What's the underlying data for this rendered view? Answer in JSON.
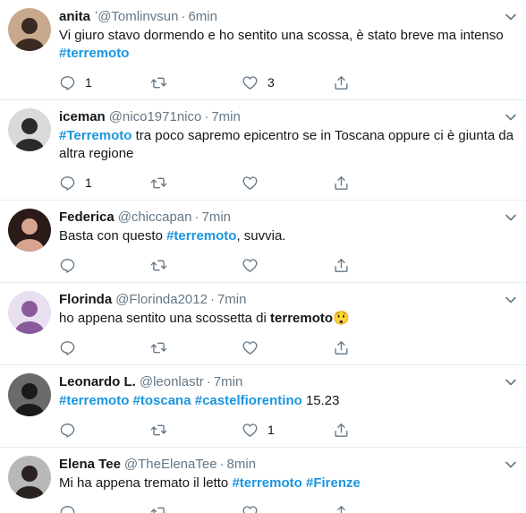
{
  "tweets": [
    {
      "name": "anita ͘͘",
      "handle": "@Tomlinvsun",
      "time": "6min",
      "text_parts": [
        {
          "t": "Vi giuro stavo dormendo e ho sentito una scossa, è stato breve ma intenso "
        },
        {
          "t": "#terremoto",
          "tag": true
        }
      ],
      "reply_count": "1",
      "retweet_count": "",
      "like_count": "3",
      "avatar_colors": [
        "#c9a98e",
        "#3a2a22"
      ]
    },
    {
      "name": "iceman",
      "handle": "@nico1971nico",
      "time": "7min",
      "text_parts": [
        {
          "t": "#Terremoto",
          "tag": true
        },
        {
          "t": " tra poco sapremo epicentro se in Toscana oppure ci è giunta da altra regione"
        }
      ],
      "reply_count": "1",
      "retweet_count": "",
      "like_count": "",
      "avatar_colors": [
        "#d9d9d9",
        "#2b2b2b"
      ]
    },
    {
      "name": "Federica",
      "handle": "@chiccapan",
      "time": "7min",
      "text_parts": [
        {
          "t": "Basta con questo "
        },
        {
          "t": "#terremoto",
          "tag": true
        },
        {
          "t": ", suvvia."
        }
      ],
      "reply_count": "",
      "retweet_count": "",
      "like_count": "",
      "avatar_colors": [
        "#2a1a18",
        "#d9a48f"
      ]
    },
    {
      "name": "Florinda",
      "handle": "@Florinda2012",
      "time": "7min",
      "text_parts": [
        {
          "t": "ho appena sentito una scossetta di "
        },
        {
          "t": "terremoto",
          "strong": true
        },
        {
          "t": "😲",
          "emoji": true
        }
      ],
      "reply_count": "",
      "retweet_count": "",
      "like_count": "",
      "avatar_colors": [
        "#e8e0f0",
        "#8a5a9a"
      ]
    },
    {
      "name": "Leonardo L.",
      "handle": "@leonlastr",
      "time": "7min",
      "text_parts": [
        {
          "t": "#terremoto",
          "tag": true
        },
        {
          "t": " "
        },
        {
          "t": "#toscana",
          "tag": true
        },
        {
          "t": " "
        },
        {
          "t": "#castelfiorentino",
          "tag": true
        },
        {
          "t": " 15.23"
        }
      ],
      "reply_count": "",
      "retweet_count": "",
      "like_count": "1",
      "avatar_colors": [
        "#6a6a6a",
        "#1a1a1a"
      ]
    },
    {
      "name": "Elena Tee",
      "handle": "@TheElenaTee",
      "time": "8min",
      "text_parts": [
        {
          "t": "Mi ha appena tremato il letto "
        },
        {
          "t": "#terremoto",
          "tag": true
        },
        {
          "t": " "
        },
        {
          "t": "#Firenze",
          "tag": true
        }
      ],
      "reply_count": "",
      "retweet_count": "",
      "like_count": "",
      "avatar_colors": [
        "#b8b8b8",
        "#2a2220"
      ]
    }
  ],
  "colors": {
    "link": "#1b95e0",
    "muted": "#657786",
    "text": "#14171a",
    "divider": "#e6ecf0"
  },
  "icons": {
    "reply": "reply-icon",
    "retweet": "retweet-icon",
    "like": "like-icon",
    "share": "share-icon",
    "caret": "chevron-down-icon"
  }
}
